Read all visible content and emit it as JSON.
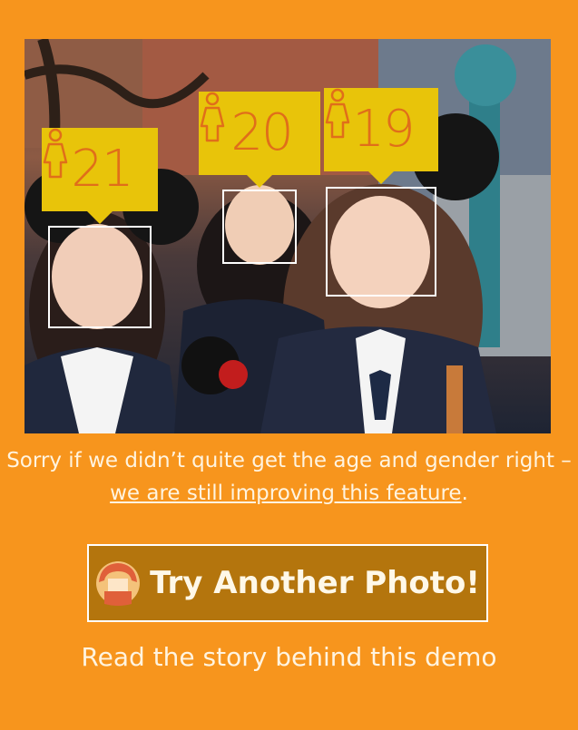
{
  "photo": {
    "faces": [
      {
        "age": "21",
        "gender": "female"
      },
      {
        "age": "20",
        "gender": "female"
      },
      {
        "age": "19",
        "gender": "female"
      }
    ]
  },
  "message": {
    "text_before": "Sorry if we didn’t quite get the age and gender right – ",
    "link_text": "we are still improving this feature",
    "text_after": "."
  },
  "try_button": {
    "label": "Try Another Photo!",
    "icon": "face-avatar-icon"
  },
  "story_link": "Read the story behind this demo",
  "colors": {
    "background": "#F7951D",
    "tag": "#E8C40A",
    "tag_text": "#E06E1A",
    "button": "#B4750D"
  }
}
